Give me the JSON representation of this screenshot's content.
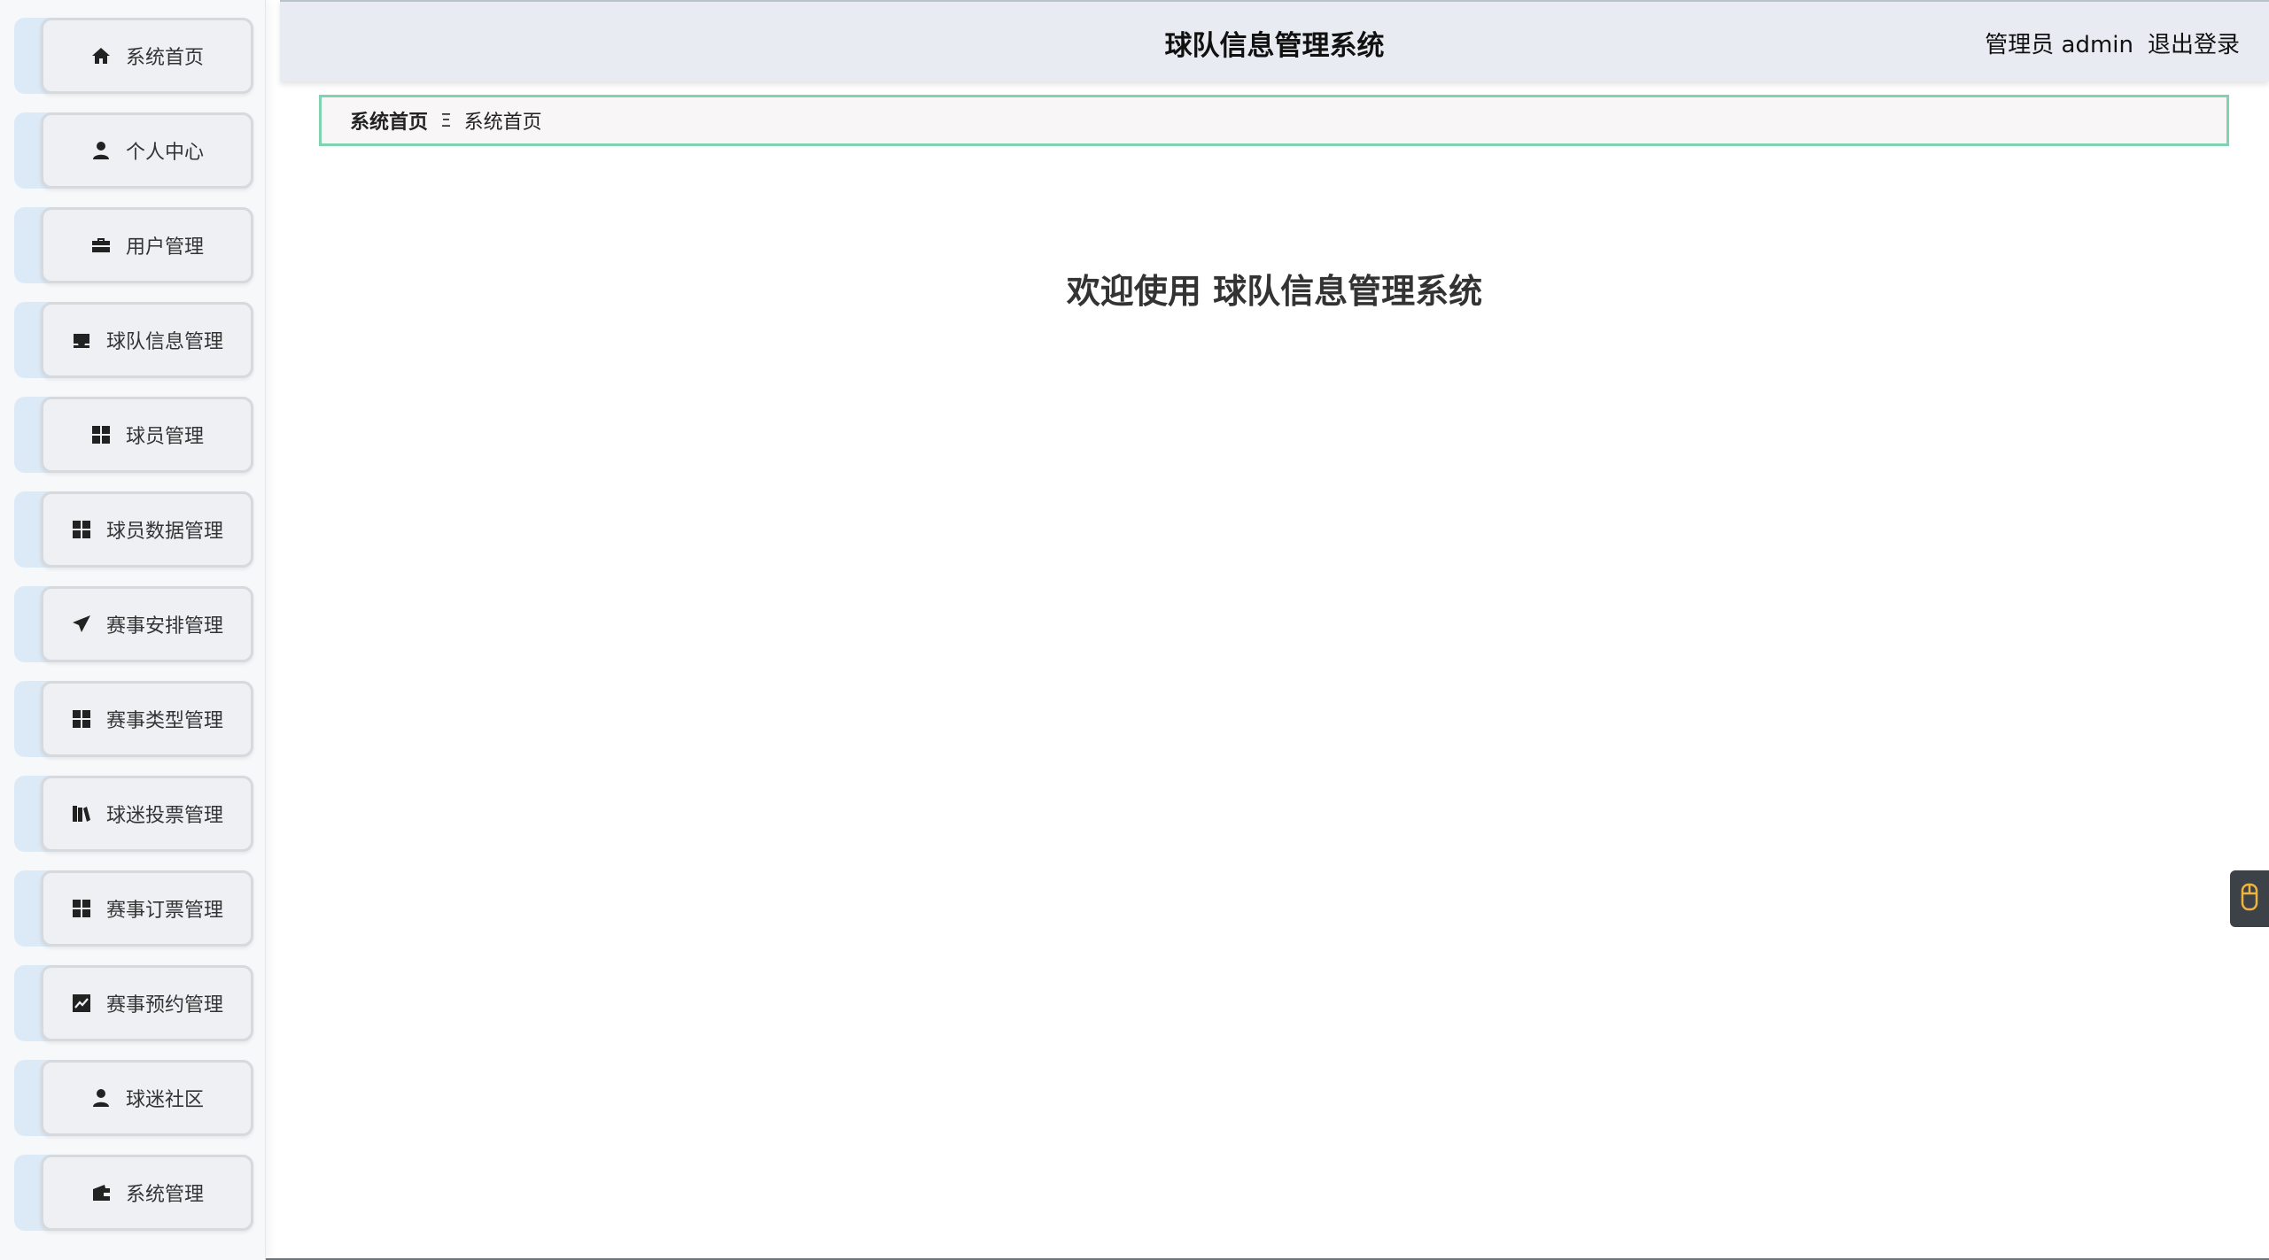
{
  "header": {
    "title": "球队信息管理系统",
    "user_label": "管理员 admin",
    "logout_label": "退出登录"
  },
  "sidebar": {
    "items": [
      {
        "label": "系统首页",
        "icon": "home-icon"
      },
      {
        "label": "个人中心",
        "icon": "user-icon"
      },
      {
        "label": "用户管理",
        "icon": "briefcase-icon"
      },
      {
        "label": "球队信息管理",
        "icon": "inbox-icon"
      },
      {
        "label": "球员管理",
        "icon": "grid-icon"
      },
      {
        "label": "球员数据管理",
        "icon": "grid-icon"
      },
      {
        "label": "赛事安排管理",
        "icon": "paper-plane-icon"
      },
      {
        "label": "赛事类型管理",
        "icon": "grid-icon"
      },
      {
        "label": "球迷投票管理",
        "icon": "books-icon"
      },
      {
        "label": "赛事订票管理",
        "icon": "grid-icon"
      },
      {
        "label": "赛事预约管理",
        "icon": "chart-icon"
      },
      {
        "label": "球迷社区",
        "icon": "user-icon"
      },
      {
        "label": "系统管理",
        "icon": "wallet-icon"
      }
    ]
  },
  "breadcrumb": {
    "home": "系统首页",
    "separator": "Ξ",
    "current": "系统首页"
  },
  "main": {
    "welcome": "欢迎使用 球队信息管理系统"
  },
  "float_tab": {
    "icon": "mouse-icon"
  }
}
